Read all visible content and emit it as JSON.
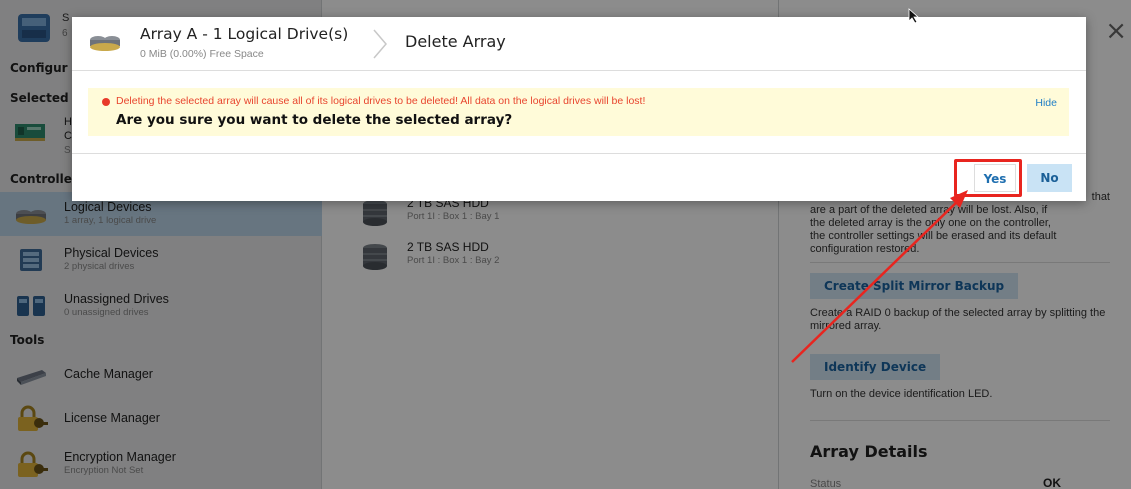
{
  "sidebar": {
    "header": {
      "title": "S",
      "subtitle": "6"
    },
    "section_configure": "Configur",
    "section_selected": "Selected",
    "selected_item": {
      "line1": "H",
      "line2": "C",
      "line3": "S"
    },
    "section_controller": "Controlle",
    "nav_items": [
      {
        "label": "Logical Devices",
        "sub": "1 array, 1 logical drive",
        "icon": "logical-devices-icon"
      },
      {
        "label": "Physical Devices",
        "sub": "2 physical drives",
        "icon": "physical-devices-icon"
      },
      {
        "label": "Unassigned Drives",
        "sub": "0 unassigned drives",
        "icon": "unassigned-drives-icon"
      }
    ],
    "section_tools": "Tools",
    "tools": [
      {
        "label": "Cache Manager",
        "sub": "",
        "icon": "cache-manager-icon"
      },
      {
        "label": "License Manager",
        "sub": "",
        "icon": "license-manager-icon"
      },
      {
        "label": "Encryption Manager",
        "sub": "Encryption Not Set",
        "icon": "encryption-manager-icon"
      }
    ]
  },
  "main": {
    "drives": [
      {
        "name": "2 TB SAS HDD",
        "location": "Port 1I : Box 1 : Bay 1"
      },
      {
        "name": "2 TB SAS HDD",
        "location": "Port 1I : Box 1 : Bay 2"
      }
    ]
  },
  "right_panel": {
    "close_glyph": "×",
    "desc_lines": [
      "that",
      "are a part of the deleted array will be lost. Also, if",
      "the deleted array is the only one on the controller,",
      "the controller settings will be erased and its default",
      "configuration restored."
    ],
    "actions": [
      {
        "label": "Create Split Mirror Backup",
        "desc": "Create a RAID 0 backup of the selected array by splitting the mirrored array."
      },
      {
        "label": "Identify Device",
        "desc": "Turn on the device identification LED."
      }
    ],
    "details_title": "Array Details",
    "status_label": "Status",
    "status_value": "OK"
  },
  "modal": {
    "title": "Array A - 1 Logical Drive(s)",
    "subtitle": "0 MiB (0.00%) Free Space",
    "breadcrumb": "Delete Array",
    "warning": "Deleting the selected array will cause all of its logical drives to be deleted! All data on the logical drives will be lost!",
    "question": "Are you sure you want to delete the selected array?",
    "hide_label": "Hide",
    "yes_label": "Yes",
    "no_label": "No"
  },
  "colors": {
    "highlight": "#e8251f",
    "accent": "#1f6fb0",
    "warning_text": "#e8452e",
    "alert_bg": "#fffbd9"
  }
}
